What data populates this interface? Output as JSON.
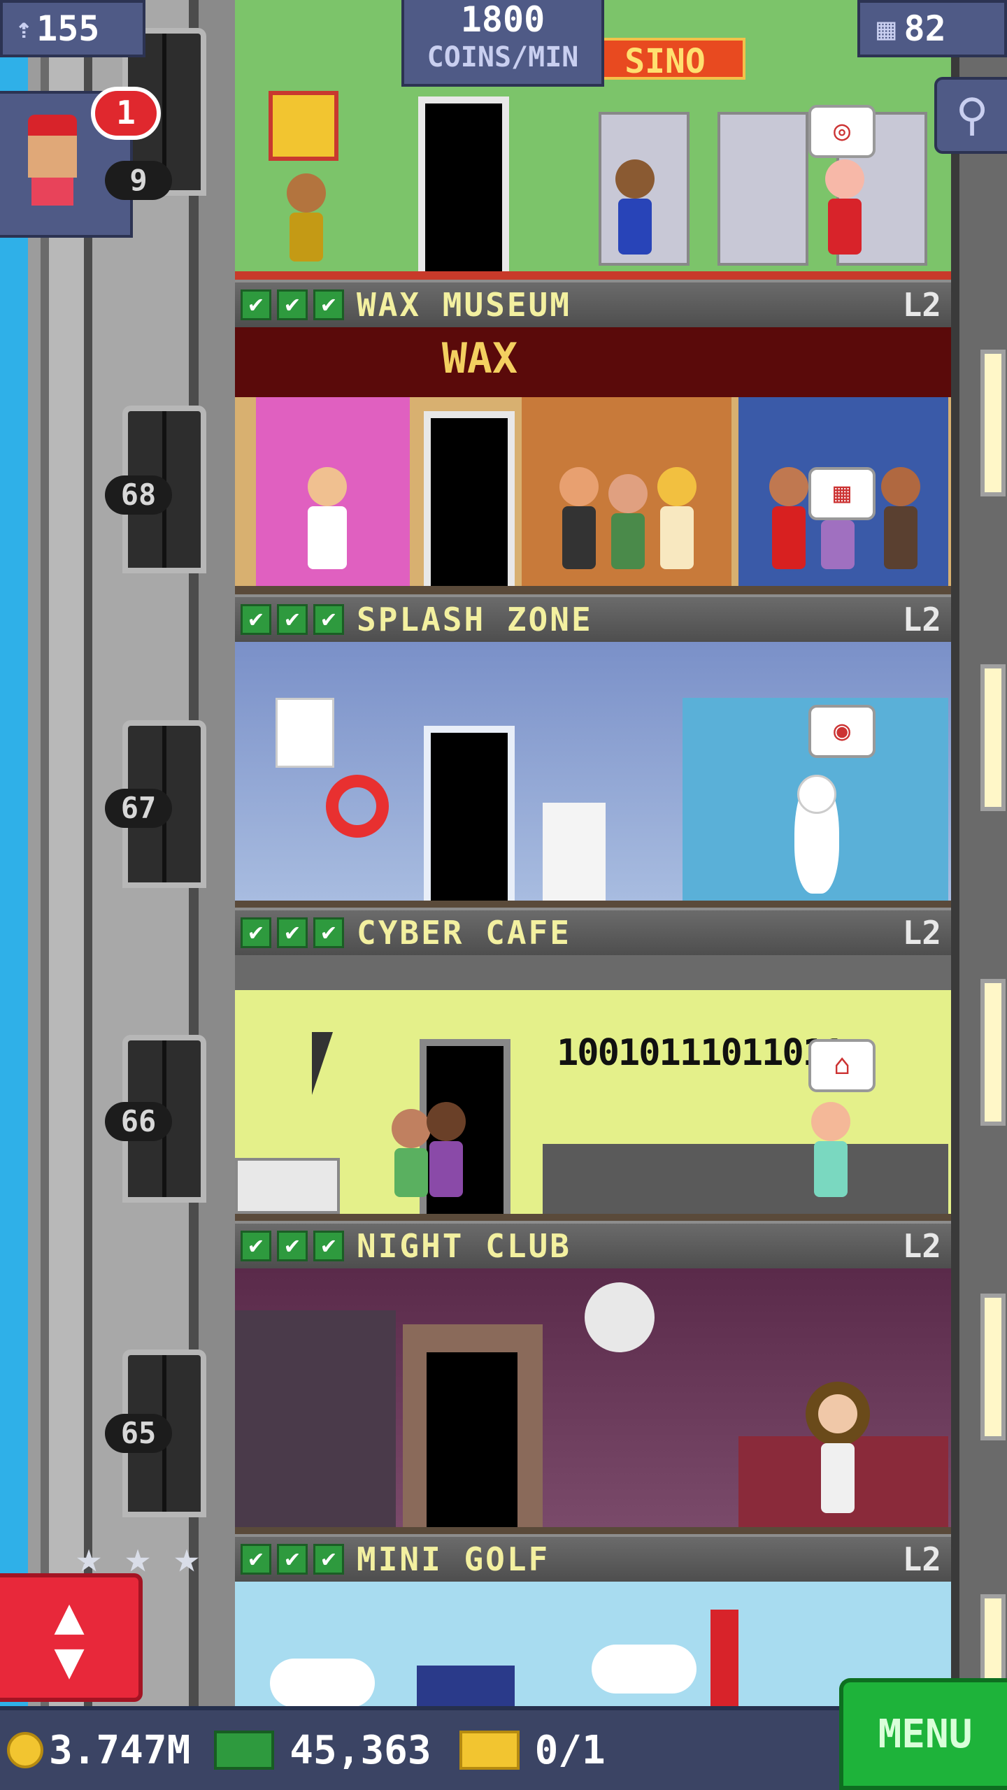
{
  "hud": {
    "population": "155",
    "coins_per_min_value": "1800",
    "coins_per_min_label": "COINS/MIN",
    "floors_count": "82",
    "visitor_badge": "1"
  },
  "floors": [
    {
      "name": "CASINO",
      "level": "",
      "number": "9"
    },
    {
      "name": "WAX MUSEUM",
      "level": "L2",
      "number": "68",
      "sign": "WAX"
    },
    {
      "name": "SPLASH ZONE",
      "level": "L2",
      "number": "67"
    },
    {
      "name": "CYBER CAFE",
      "level": "L2",
      "number": "66",
      "screen_text": "10010111011011"
    },
    {
      "name": "NIGHT CLUB",
      "level": "L2",
      "number": "65"
    },
    {
      "name": "MINI GOLF",
      "level": "L2",
      "number": ""
    }
  ],
  "casino_sign": "SINO",
  "bottom": {
    "coins": "3.747M",
    "bux": "45,363",
    "tickets": "0/1",
    "menu_label": "MENU"
  },
  "icons": {
    "check": "✔",
    "star": "★",
    "elevator_arrows": [
      "▲",
      "▼"
    ]
  },
  "colors": {
    "hud_bg": "#4f5a86",
    "check_green": "#2e9a3e",
    "floor_title": "#f3f0a0",
    "menu_green": "#1eb33a",
    "elevator_red": "#e8283a"
  }
}
